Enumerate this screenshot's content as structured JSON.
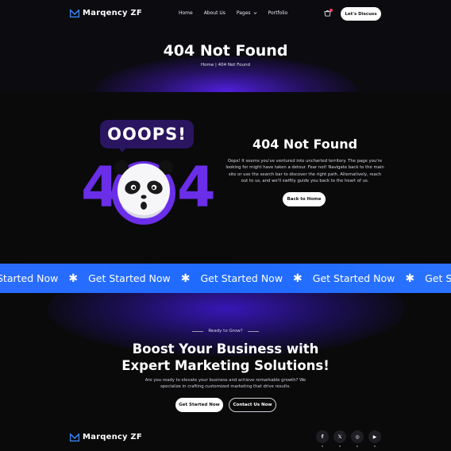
{
  "brand": {
    "name": "Marqency ZF",
    "accent": "#6a2ee8",
    "blue": "#1f6bff"
  },
  "nav": {
    "links": [
      "Home",
      "About Us",
      "Pages",
      "Portfolio"
    ],
    "cta": "Let's Discuss"
  },
  "hero": {
    "title": "404 Not Found",
    "breadcrumb": "Home | 404 Not Found"
  },
  "error_section": {
    "oops": "OOOPS!",
    "digit_left": "4",
    "digit_right": "4",
    "title": "404 Not Found",
    "text": "Oops! It seems you've ventured into uncharted territory. The page you're looking for might have taken a detour. Fear not! Navigate back to the main site or use the search bar to discover the right path. Alternatively, reach out to us, and we'll swiftly guide you back to the heart of us.",
    "button": "Back to Home"
  },
  "marquee": {
    "items": [
      "Started Now",
      "Get Started Now",
      "Get Started Now",
      "Get Started Now",
      "Get Started"
    ],
    "separator": "✱"
  },
  "cta": {
    "eyebrow": "Ready to Grow?",
    "title_line1": "Boost Your Business with",
    "title_line2": "Expert Marketing Solutions!",
    "text": "Are you ready to elevate your business and achieve remarkable growth? We specialize in crafting customized marketing that drive results.",
    "primary_button": "Get Started Now",
    "secondary_button": "Contact Us Now"
  },
  "footer": {
    "socials": [
      {
        "icon": "facebook-icon",
        "glyph": "f"
      },
      {
        "icon": "x-twitter-icon",
        "glyph": "𝕏"
      },
      {
        "icon": "instagram-icon",
        "glyph": "◎"
      },
      {
        "icon": "youtube-icon",
        "glyph": "▶"
      }
    ]
  }
}
